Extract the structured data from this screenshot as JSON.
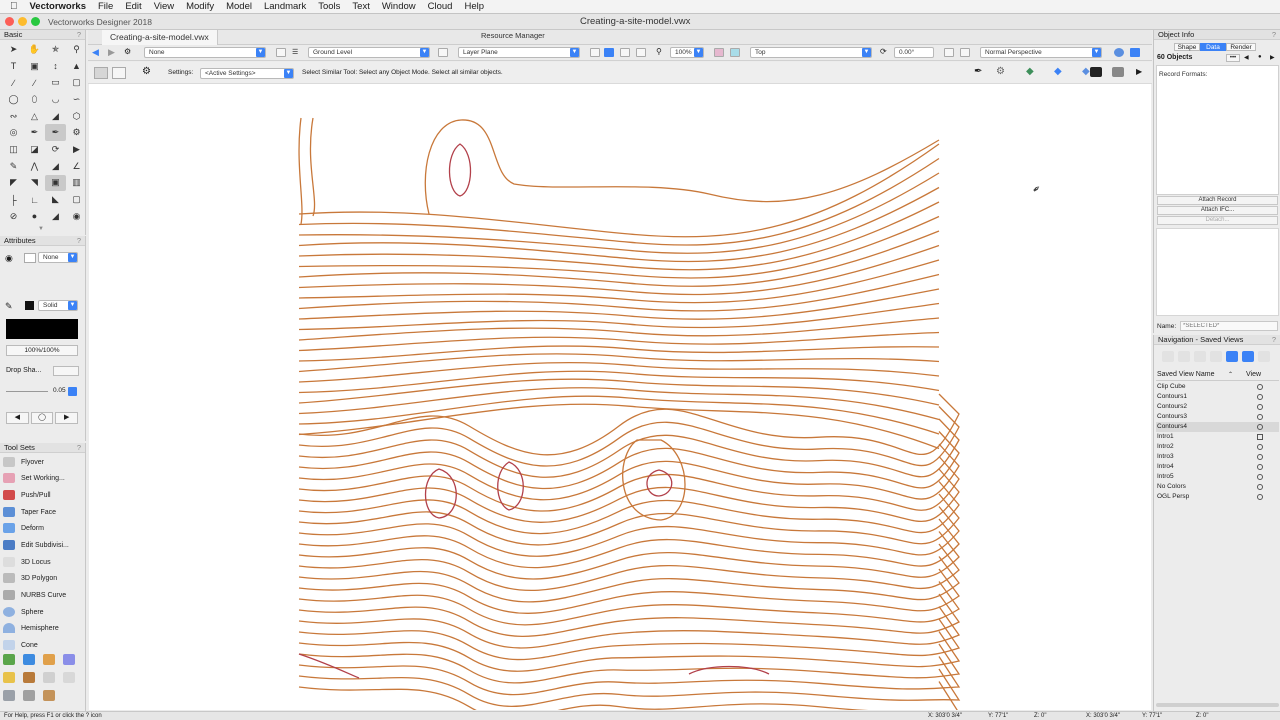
{
  "menubar": {
    "app": "Vectorworks",
    "items": [
      "File",
      "Edit",
      "View",
      "Modify",
      "Model",
      "Landmark",
      "Tools",
      "Text",
      "Window",
      "Cloud",
      "Help"
    ]
  },
  "window": {
    "app_title": "Vectorworks Designer 2018",
    "doc_title": "Creating-a-site-model.vwx"
  },
  "tabs": {
    "doc": "Creating-a-site-model.vwx",
    "resource": "Resource Manager"
  },
  "basic": {
    "title": "Basic",
    "q": "?"
  },
  "attributes": {
    "title": "Attributes",
    "fill_value": "None",
    "pen_value": "Solid",
    "opacity": "100%/100%",
    "drop_shadow": "Drop Sha...",
    "line_weight": "0.05"
  },
  "toolsets": {
    "title": "Tool Sets",
    "items": [
      "Flyover",
      "Set Working...",
      "Push/Pull",
      "Taper Face",
      "Deform",
      "Edit Subdivisi...",
      "3D Locus",
      "3D Polygon",
      "NURBS Curve",
      "Sphere",
      "Hemisphere",
      "Cone"
    ]
  },
  "viewbar": {
    "class": "None",
    "layer": "Ground Level",
    "plane": "Layer Plane",
    "zoom": "100%",
    "view": "Top",
    "rotation": "0.00°",
    "render": "Normal Perspective"
  },
  "modebar": {
    "settings_label": "Settings:",
    "settings_value": "<Active Settings>",
    "help": "Select Similar Tool: Select any Object Mode. Select all similar objects."
  },
  "statusbar": {
    "help": "For Help, press F1 or click the ? icon",
    "x1": "X: 303'0 3/4\"",
    "y1": "Y: 77'1\"",
    "z1": "Z: 0\"",
    "x2": "X: 303'0 3/4\"",
    "y2": "Y: 77'1\"",
    "z2": "Z: 0\""
  },
  "objinfo": {
    "title": "Object Info",
    "tabs": [
      "Shape",
      "Data",
      "Render"
    ],
    "active_tab": "Data",
    "count": "60 Objects",
    "record_formats": "Record Formats:",
    "attach_record": "Attach Record",
    "attach_ifc": "Attach IFC...",
    "detach": "Detach...",
    "name_label": "Name:",
    "name_placeholder": "*SELECTED*"
  },
  "nav": {
    "title": "Navigation - Saved Views",
    "col_name": "Saved View Name",
    "col_view": "View",
    "views": [
      "Clip Cube",
      "Contours1",
      "Contours2",
      "Contours3",
      "Contours4",
      "Intro1",
      "Intro2",
      "Intro3",
      "Intro4",
      "Intro5",
      "No Colors",
      "OGL Persp"
    ],
    "selected": "Contours4"
  },
  "colors": {
    "contour": "#c8783a",
    "contour_red": "#b2404a",
    "accent": "#3b82f6"
  }
}
